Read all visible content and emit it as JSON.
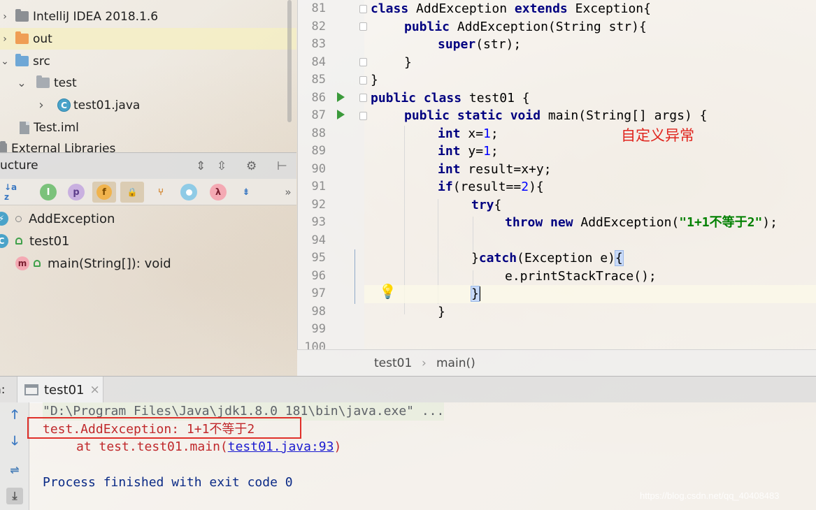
{
  "project_tree": {
    "items": [
      {
        "label": "IntelliJ IDEA 2018.1.6"
      },
      {
        "label": "out"
      },
      {
        "label": "src"
      },
      {
        "label": "test"
      },
      {
        "label": "test01.java"
      },
      {
        "label": "Test.iml"
      },
      {
        "label": "External Libraries"
      }
    ]
  },
  "structure": {
    "title": "ucture",
    "toolbar": {
      "sort_alpha": "↓a z",
      "inherited": "I",
      "properties": "p",
      "fields": "f",
      "nonpublic": "🔒",
      "more": "»"
    },
    "items": [
      {
        "label": "AddException"
      },
      {
        "label": "test01"
      },
      {
        "label": "main(String[]): void",
        "icon_letter": "m"
      }
    ]
  },
  "editor": {
    "line_numbers": [
      "81",
      "82",
      "83",
      "84",
      "85",
      "86",
      "87",
      "88",
      "89",
      "90",
      "91",
      "92",
      "93",
      "94",
      "95",
      "96",
      "97",
      "98",
      "99",
      "100"
    ],
    "lines": [
      {
        "kw1": "class",
        "t1": " AddException ",
        "kw2": "extends",
        "t2": " Exception{"
      },
      {
        "kw1": "public",
        "t1": " AddException(String str){"
      },
      {
        "kw1": "super",
        "t1": "(str);"
      },
      {
        "t1": "}"
      },
      {
        "t1": "}"
      },
      {
        "kw1": "public class",
        "t1": " test01 {"
      },
      {
        "kw1": "public static void",
        "t1": " main(String[] args) {"
      },
      {
        "kw1": "int",
        "t1": " x=",
        "n1": "1",
        "t2": ";"
      },
      {
        "kw1": "int",
        "t1": " y=",
        "n1": "1",
        "t2": ";"
      },
      {
        "kw1": "int",
        "t1": " result=x+y;"
      },
      {
        "kw1": "if",
        "t1": "(result==",
        "n1": "2",
        "t2": "){"
      },
      {
        "kw1": "try",
        "t1": "{"
      },
      {
        "kw1": "throw new",
        "t1": " AddException(",
        "s1": "\"1+1不等于2\"",
        "t2": ");"
      },
      {
        "t1": ""
      },
      {
        "t1": "}",
        "kw1": "catch",
        "t2": "(Exception e)",
        "hl": "{"
      },
      {
        "t1": "e.printStackTrace();"
      },
      {
        "hl": "}"
      },
      {
        "t1": "}"
      },
      {
        "t1": ""
      },
      {
        "t1": ""
      }
    ],
    "annotation": "自定义异常"
  },
  "breadcrumb": {
    "items": [
      "test01",
      "main()"
    ],
    "separator": "›"
  },
  "run_panel": {
    "label": "n:",
    "tab": {
      "label": "test01",
      "close": "×"
    },
    "console": {
      "cmd_line": "\"D:\\Program Files\\Java\\jdk1.8.0_181\\bin\\java.exe\" ...",
      "error_line": "test.AddException: 1+1不等于2",
      "at_prefix": "at test.test01.main(",
      "at_link": "test01.java:93",
      "at_suffix": ")",
      "done_line": "Process finished with exit code 0"
    }
  },
  "watermark": "https://blog.csdn.net/qq_40408483",
  "colors": {
    "keyword": "#000080",
    "string": "#008000",
    "number": "#0000ff",
    "error_text": "#c0282b",
    "annotation": "#e0251e",
    "highlight_box": "#e0302a"
  }
}
